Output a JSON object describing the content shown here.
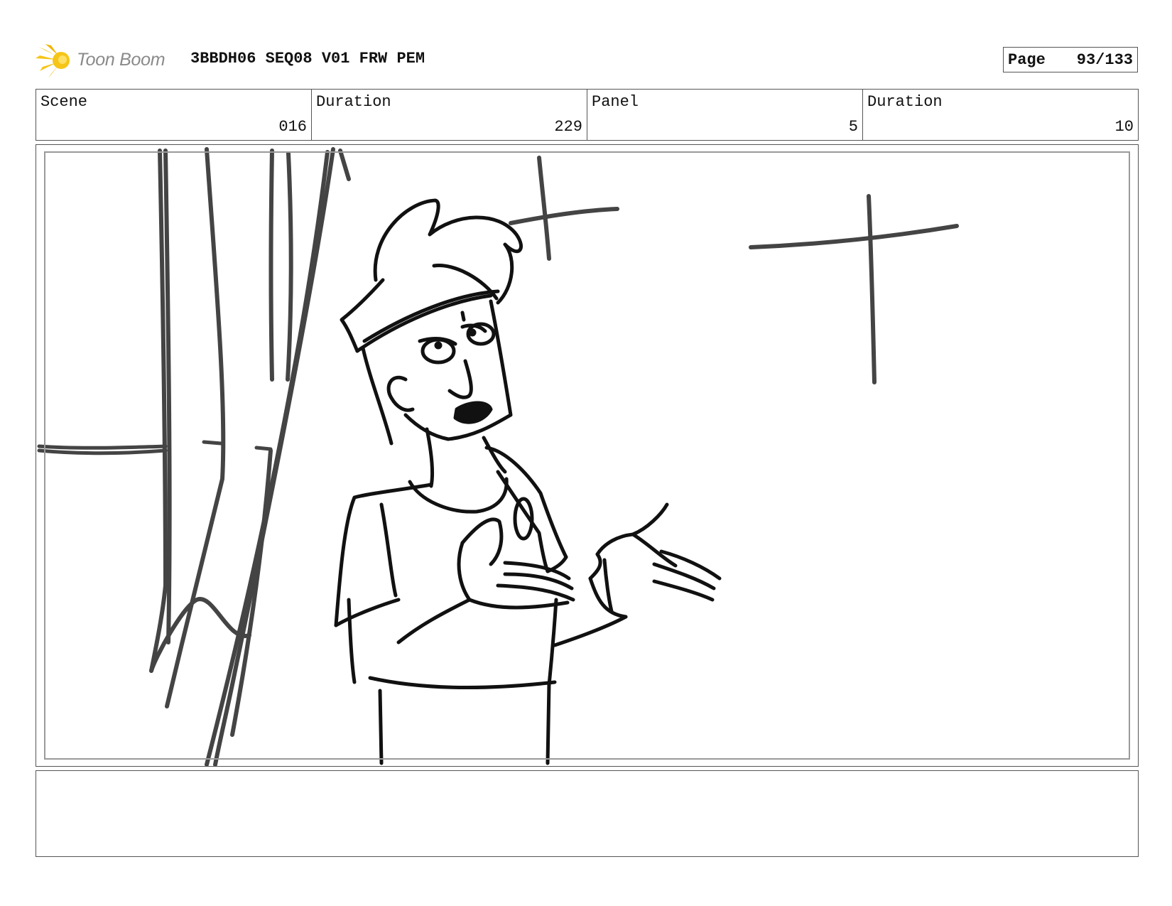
{
  "header": {
    "logo": {
      "text": "Toon Boom",
      "icon": "toon-boom-star-icon",
      "color": "#f5c518"
    },
    "project_title": "3BBDH06 SEQ08 V01 FRW PEM",
    "page": {
      "label": "Page",
      "value": "93/133"
    }
  },
  "info": {
    "scene": {
      "label": "Scene",
      "value": "016"
    },
    "scene_duration": {
      "label": "Duration",
      "value": "229"
    },
    "panel": {
      "label": "Panel",
      "value": "5"
    },
    "panel_duration": {
      "label": "Duration",
      "value": "10"
    }
  },
  "notes": {
    "text": ""
  }
}
